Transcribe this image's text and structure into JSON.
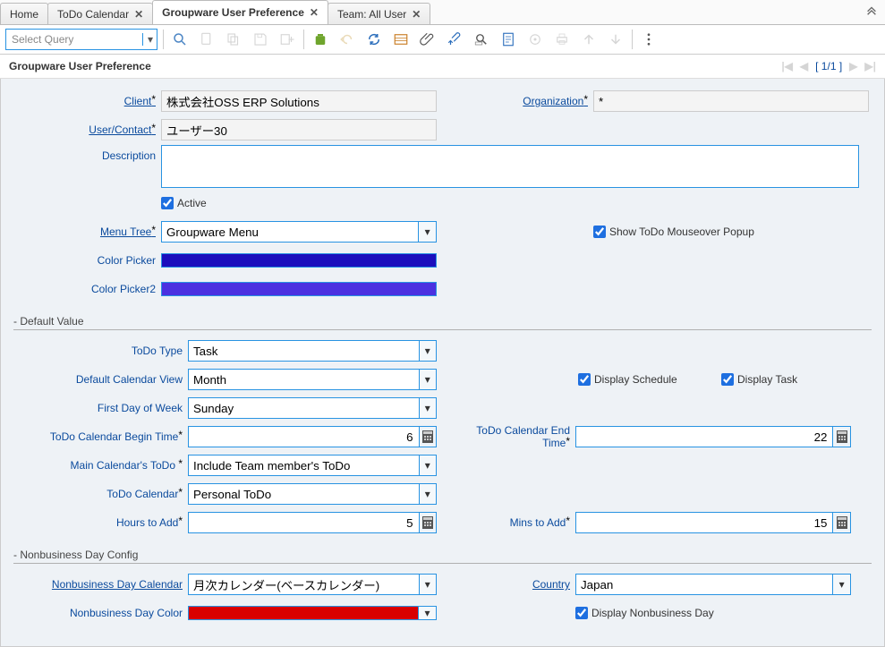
{
  "tabs": {
    "home": "Home",
    "todo": "ToDo Calendar",
    "pref": "Groupware User Preference",
    "team": "Team: All User"
  },
  "query": {
    "placeholder": "Select Query"
  },
  "title": "Groupware User Preference",
  "pager": {
    "text": "[ 1/1 ]"
  },
  "form": {
    "client_label": "Client",
    "client_value": "株式会社OSS ERP Solutions",
    "org_label": "Organization",
    "org_value": "*",
    "user_label": "User/Contact",
    "user_value": "ユーザー30",
    "desc_label": "Description",
    "desc_value": "",
    "active_label": "Active",
    "menutree_label": "Menu Tree",
    "menutree_value": "Groupware Menu",
    "showpopup_label": "Show ToDo Mouseover Popup",
    "cpicker_label": "Color Picker",
    "cpicker_color": "#1c0fbd",
    "cpicker2_label": "Color Picker2",
    "cpicker2_color": "#4b31e0",
    "sec_default": "- Default Value",
    "todotype_label": "ToDo Type",
    "todotype_value": "Task",
    "calview_label": "Default Calendar View",
    "calview_value": "Month",
    "dispsched_label": "Display Schedule",
    "disptask_label": "Display Task",
    "firstday_label": "First Day of Week",
    "firstday_value": "Sunday",
    "begintime_label": "ToDo Calendar Begin Time",
    "begintime_value": "6",
    "endtime_label": "ToDo Calendar End Time",
    "endtime_value": "22",
    "maintodo_label": "Main Calendar's ToDo ",
    "maintodo_value": "Include Team member's ToDo",
    "todocal_label": "ToDo Calendar",
    "todocal_value": "Personal ToDo",
    "hoursadd_label": "Hours to Add",
    "hoursadd_value": "5",
    "minsadd_label": "Mins to Add",
    "minsadd_value": "15",
    "sec_nonbiz": "- Nonbusiness Day Config",
    "nb_cal_label": "Nonbusiness Day Calendar",
    "nb_cal_value": "月次カレンダー(ベースカレンダー)",
    "country_label": "Country",
    "country_value": "Japan",
    "nb_color_label": "Nonbusiness Day Color",
    "nb_color": "#d90000",
    "dispnb_label": "Display Nonbusiness Day"
  }
}
